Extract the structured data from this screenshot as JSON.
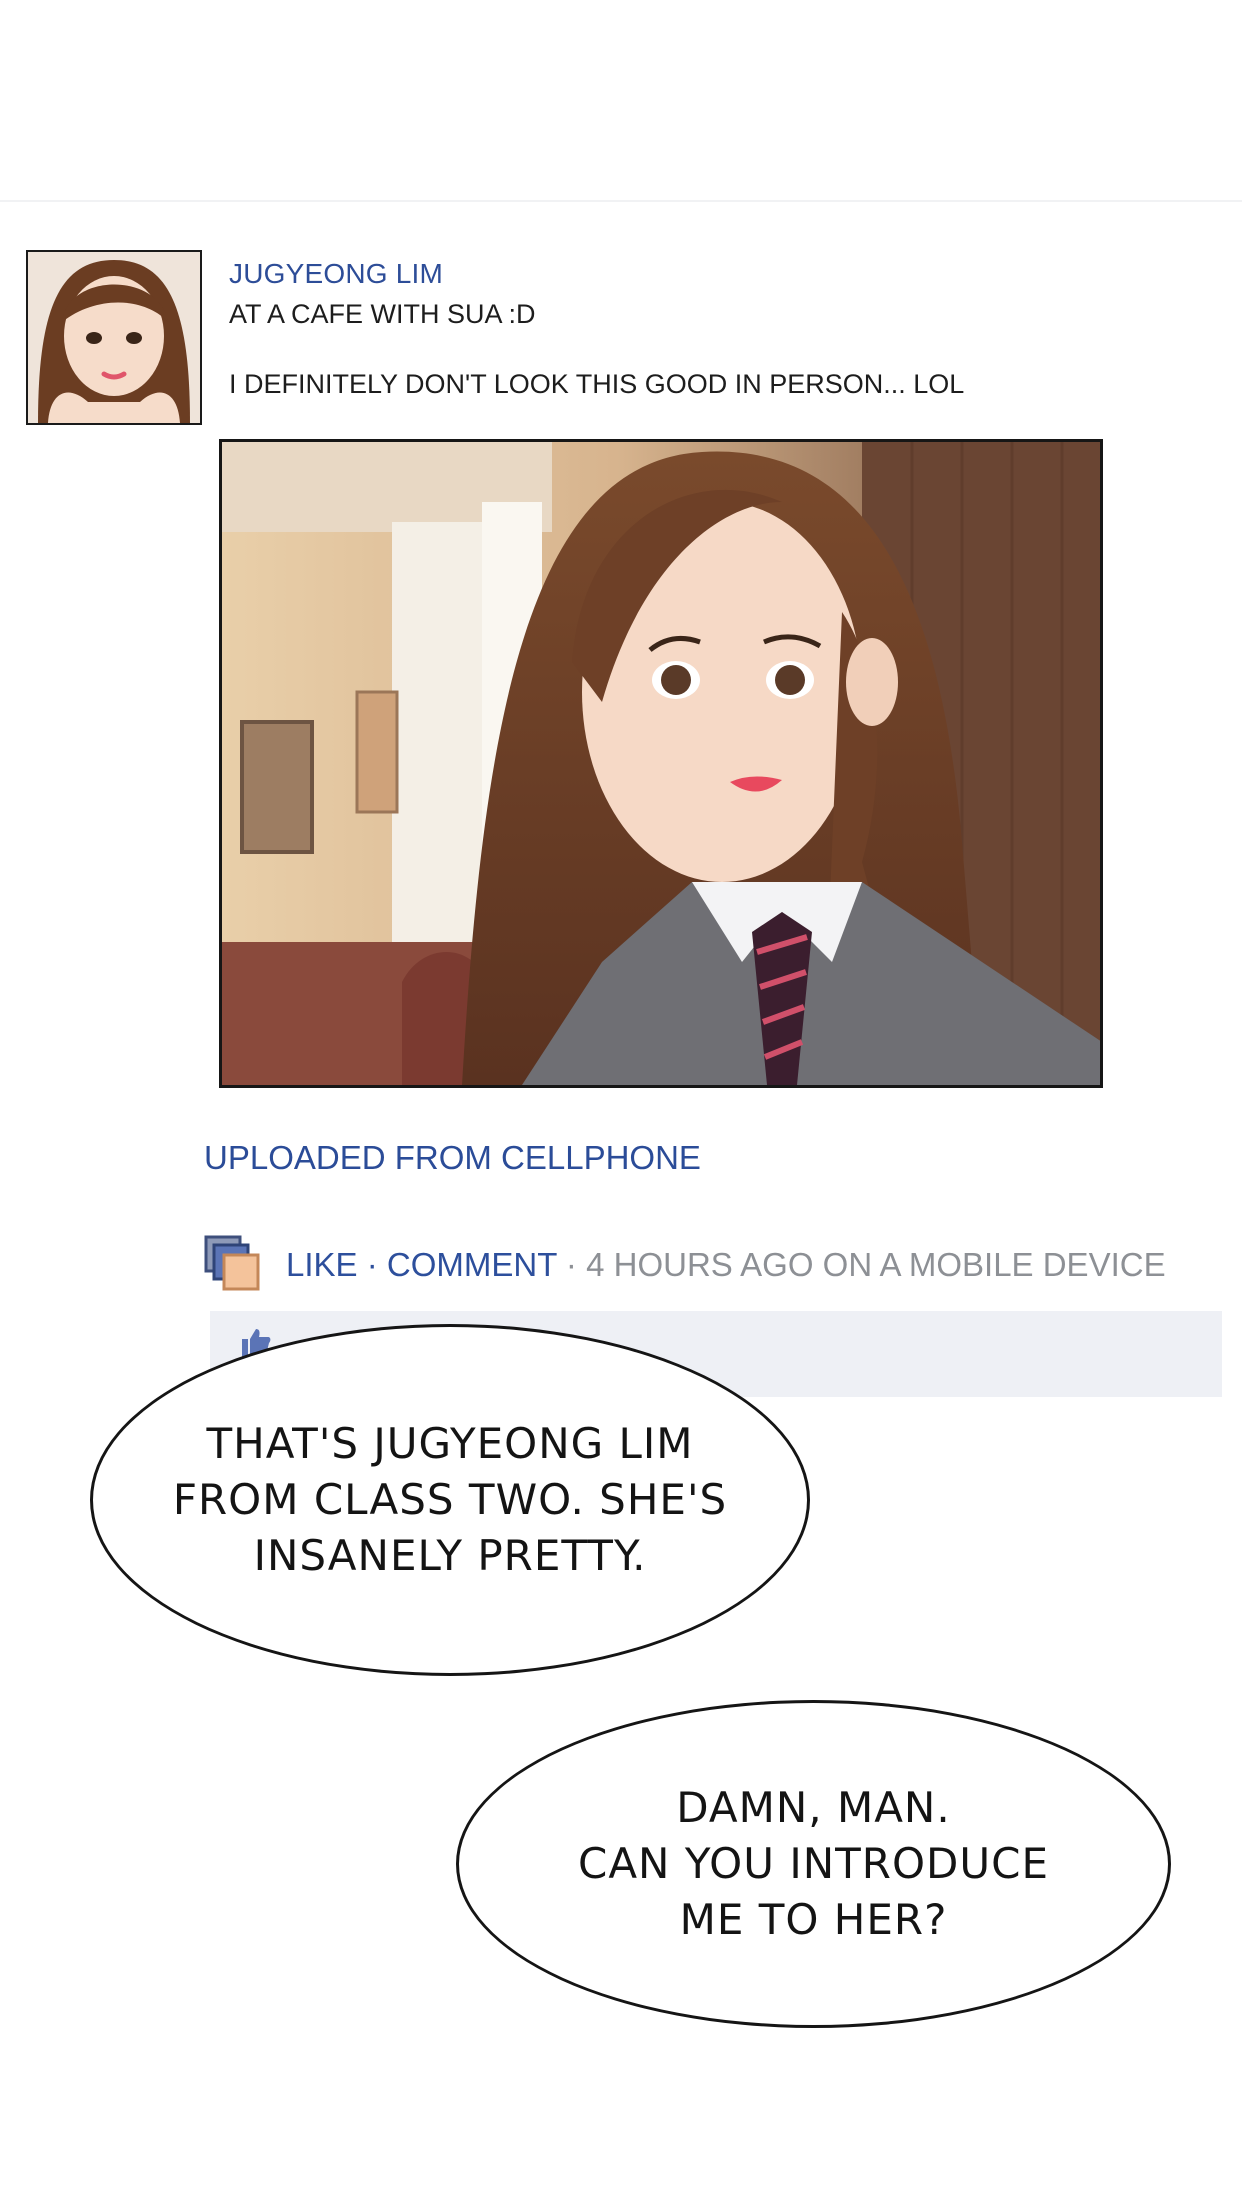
{
  "post": {
    "author_name": "JUGYEONG LIM",
    "status_line_1": "AT A CAFE WITH SUA :D",
    "status_line_2": "I DEFINITELY DON'T LOOK THIS GOOD IN PERSON... LOL",
    "upload_source": "UPLOADED FROM CELLPHONE",
    "actions": {
      "like_label": "LIKE",
      "separator": " · ",
      "comment_label": "COMMENT",
      "meta": " · 4 HOURS AGO ON A MOBILE DEVICE"
    },
    "icons": {
      "action_icon": "photos-icon",
      "strip_icon": "thumbs-up-icon"
    },
    "colors": {
      "link_blue": "#2d4f9c",
      "meta_gray": "#8d9095",
      "comment_strip": "#eef0f5"
    }
  },
  "speech_bubbles": [
    {
      "text": "THAT'S JUGYEONG LIM\nFROM CLASS TWO. SHE'S\nINSANELY PRETTY."
    },
    {
      "text": "DAMN, MAN.\nCAN YOU INTRODUCE\nME TO HER?"
    }
  ]
}
